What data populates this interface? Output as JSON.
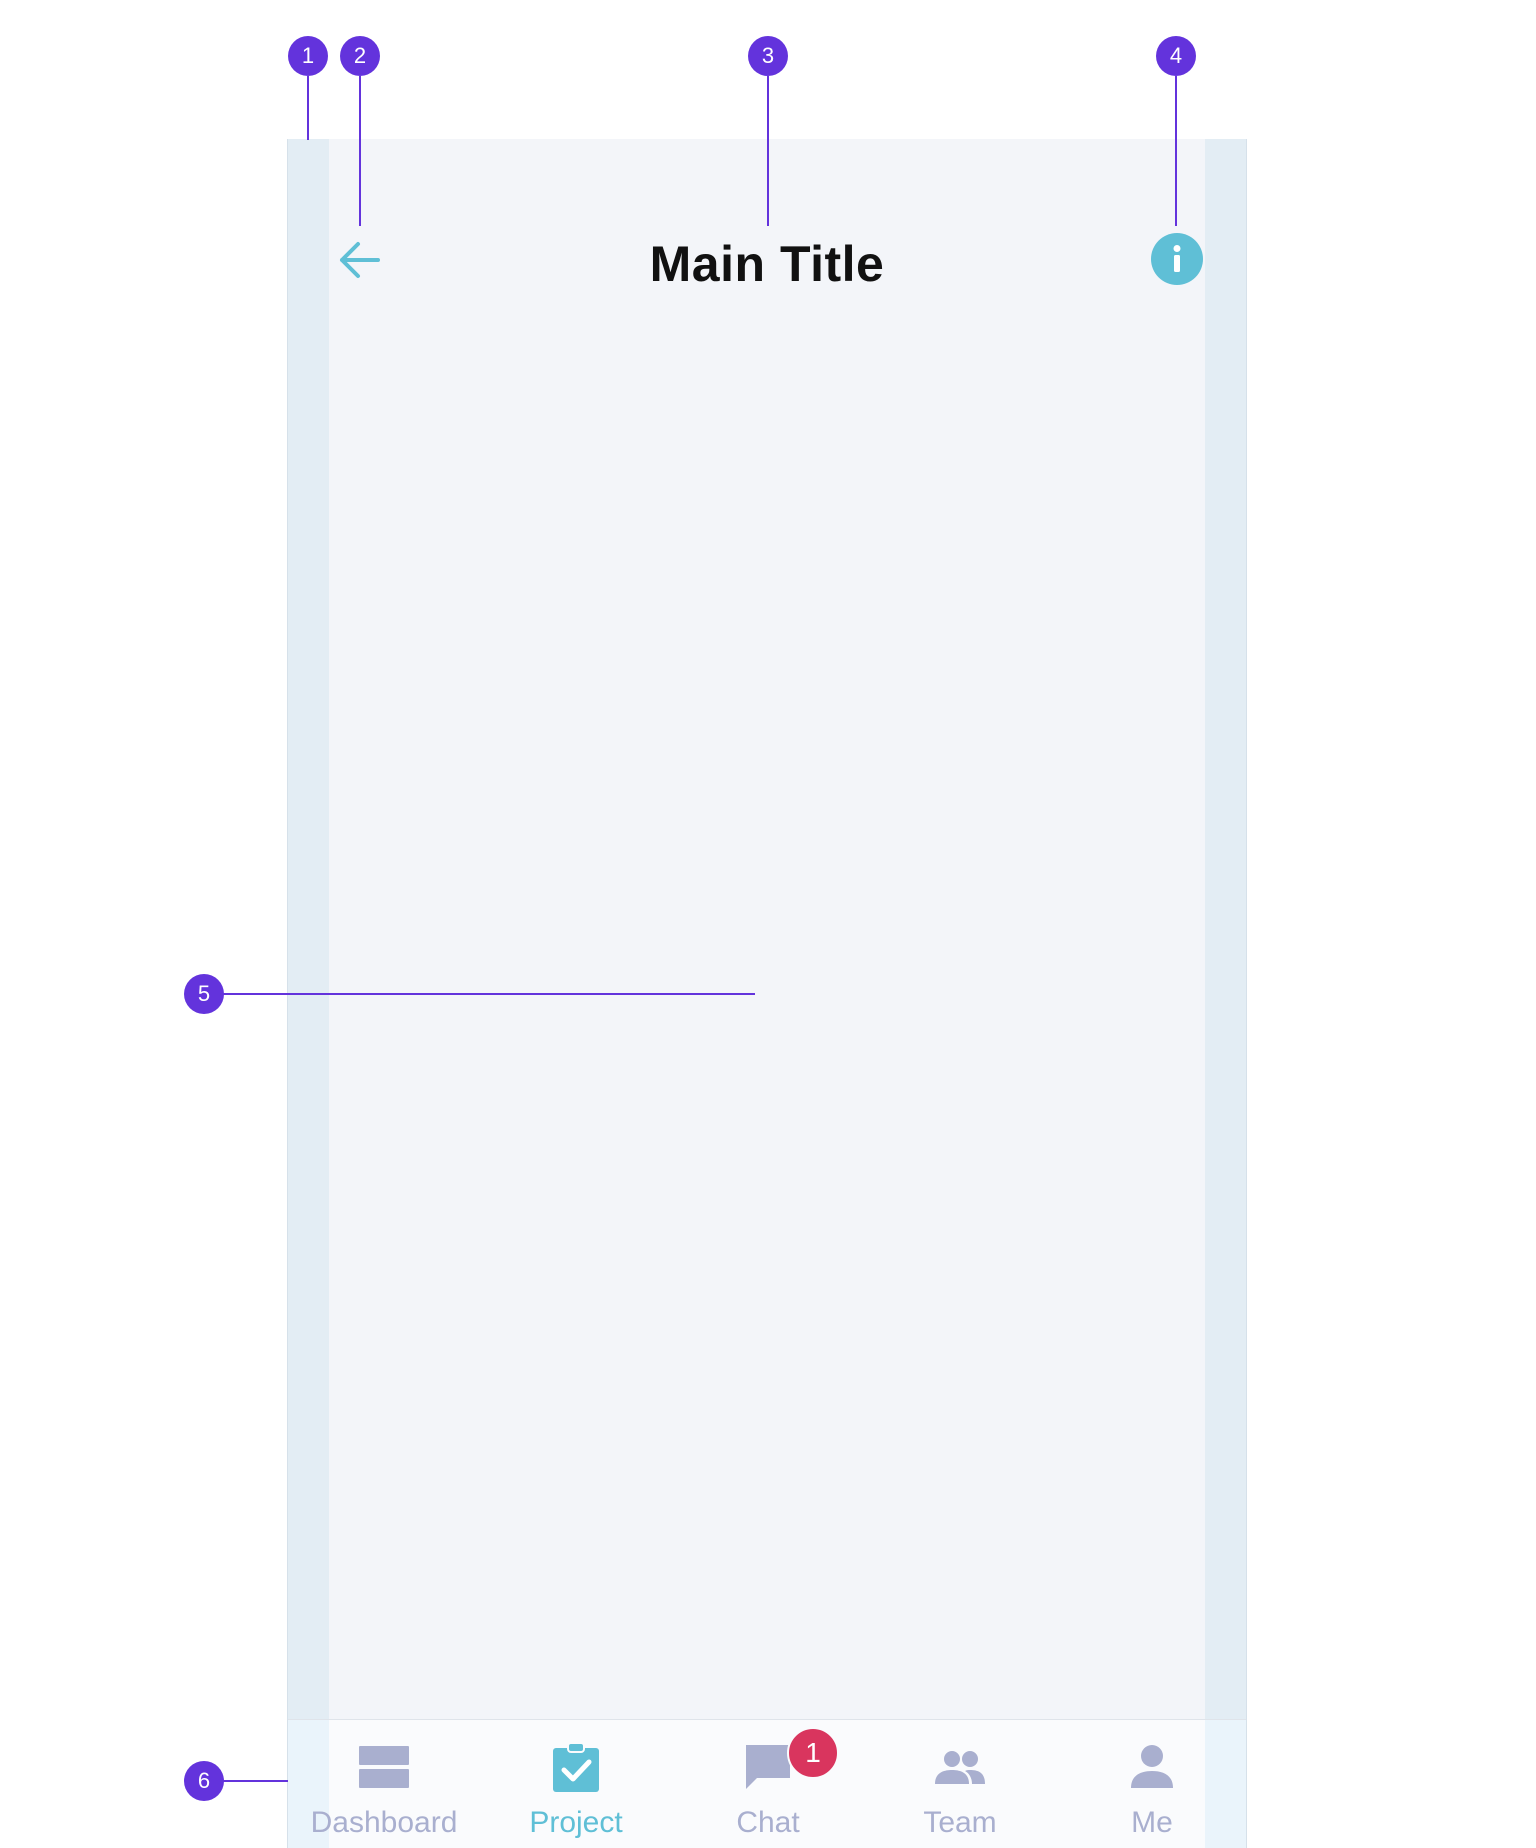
{
  "header": {
    "title": "Main Title",
    "back_icon": "arrow-left-icon",
    "info_icon": "info-icon"
  },
  "tab_bar": {
    "tabs": [
      {
        "label": "Dashboard",
        "icon": "dashboard-icon",
        "active": false
      },
      {
        "label": "Project",
        "icon": "clipboard-check-icon",
        "active": true
      },
      {
        "label": "Chat",
        "icon": "chat-bubble-icon",
        "active": false,
        "badge": "1"
      },
      {
        "label": "Team",
        "icon": "people-icon",
        "active": false
      },
      {
        "label": "Me",
        "icon": "person-icon",
        "active": false
      }
    ]
  },
  "callouts": [
    "1",
    "2",
    "3",
    "4",
    "5",
    "6"
  ],
  "colors": {
    "accent": "#5fbfd6",
    "inactive": "#a9afcf",
    "badge": "#d9355e",
    "callout": "#6333dc",
    "screen_background": "#f3f5f9",
    "margin_guide": "#e3edf4"
  }
}
